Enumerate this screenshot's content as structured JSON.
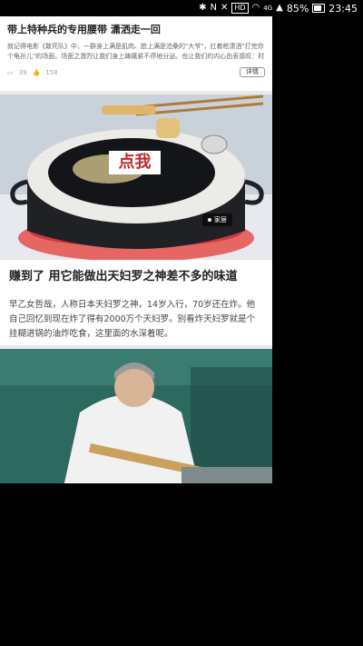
{
  "status_bar": {
    "signal": "4G",
    "battery": "85%",
    "time": "23:45",
    "icons": [
      "bluetooth-icon",
      "nfc-icon",
      "mute-icon",
      "hd-icon",
      "wifi-icon",
      "signal-icon",
      "battery-icon"
    ]
  },
  "ad_card": {
    "title": "带上特种兵的专用腰带 潇洒走一回",
    "description": "就记得电影《敢死队》中，一群身上满是肌肉、脸上满是沧桑的\"大爷\"，扛着枪潇洒\"打完你个龟孙儿\"的场面。场面之激烈让我们身上踌躇紧不停地分泌。也让我们的内心由衷感叹：时光易逝永不变，往事只能...",
    "views": "39",
    "likes": "158",
    "detail_label": "详情"
  },
  "hero": {
    "click_label": "点我",
    "tag_label": "家居"
  },
  "article": {
    "title": "赚到了 用它能做出天妇罗之神差不多的味道",
    "body": "早乙女哲哉，人称日本天妇罗之神，14岁入行，70岁还在炸。他自己回忆到现在炸了得有2000万个天妇罗。别看炸天妇罗就是个挂糊进锅的油炸吃食，这里面的水深着呢。"
  },
  "colors": {
    "click_red": "#c62828",
    "background": "#000000",
    "card_bg": "#ffffff"
  }
}
